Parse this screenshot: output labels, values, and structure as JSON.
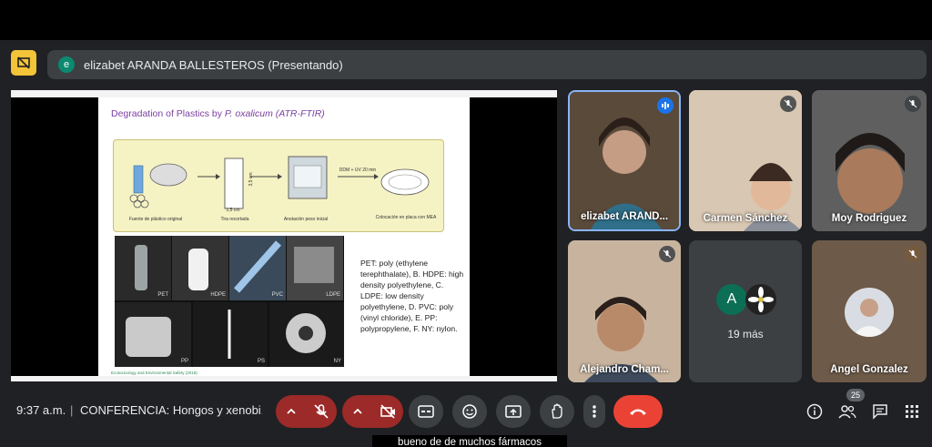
{
  "presenter_bar": {
    "avatar_initial": "e",
    "text": "elizabet ARANDA BALLESTEROS (Presentando)"
  },
  "slide": {
    "title_prefix": "Degradation of Plastics by ",
    "title_italic": "P. oxalicum (ATR-FTIR)",
    "flow_captions": [
      "Fuente de plástico original",
      "Tira recortada",
      "Anotación peso inicial",
      "Colocación en placa con MEA"
    ],
    "dim_labels": [
      "3,5 cm",
      "1,5 cm"
    ],
    "uv_label": "DDM + UV 20 min",
    "plastic_codes": [
      "PET",
      "HDPE",
      "PVC",
      "LDPE",
      "PP",
      "PS",
      "NY"
    ],
    "legend": "PET: poly (ethylene terephthalate), B. HDPE: high density polyethylene, C. LDPE: low density polyethylene, D. PVC: poly (vinyl chloride), E. PP: polypropylene, F. NY: nylon.",
    "footnote": "Ecotoxicology and Environmental Safety (2018)"
  },
  "participants": [
    {
      "name": "elizabet ARAND...",
      "speaking": true
    },
    {
      "name": "Carmen Sánchez",
      "muted": true
    },
    {
      "name": "Moy Rodriguez",
      "muted": true
    },
    {
      "name": "Alejandro Cham...",
      "muted": true
    },
    {
      "name": "19 más",
      "avatar_letter": "A"
    },
    {
      "name": "Angel Gonzalez",
      "muted": true
    }
  ],
  "bottom": {
    "time": "9:37 a.m.",
    "separator": "|",
    "meeting_title": "CONFERENCIA: Hongos y xenobi...",
    "people_count": "25"
  },
  "caption": "bueno de de muchos fármacos",
  "icons": [
    "present-icon",
    "mic-off-icon",
    "cam-off-icon",
    "captions-icon",
    "emoji-icon",
    "present-screen-icon",
    "raise-hand-icon",
    "more-icon",
    "hangup-icon",
    "info-icon",
    "people-icon",
    "chat-icon",
    "activities-icon"
  ],
  "colors": {
    "accent_yellow": "#f3c338",
    "red_off": "#9b2a28",
    "hangup": "#ea4335"
  }
}
